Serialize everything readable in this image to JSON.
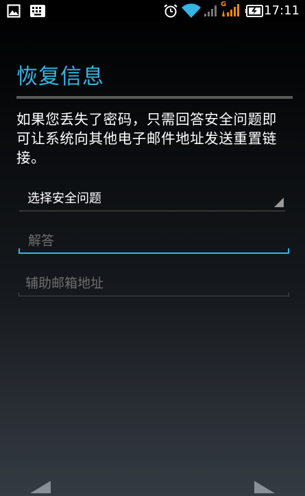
{
  "status_bar": {
    "time": "17:11",
    "network_label": "G",
    "icons": [
      "image-icon",
      "keyboard-icon",
      "alarm-icon",
      "wifi-icon",
      "signal-icon",
      "signal-icon-secondary",
      "battery-icon"
    ]
  },
  "page": {
    "title": "恢复信息",
    "description": "如果您丢失了密码，只需回答安全问题即可让系统向其他电子邮件地址发送重置链接。"
  },
  "form": {
    "security_question": {
      "selected": "选择安全问题"
    },
    "answer": {
      "placeholder": "解答",
      "value": ""
    },
    "backup_email": {
      "placeholder": "辅助邮箱地址",
      "value": ""
    }
  },
  "navigation": {
    "icons": [
      "back-arrow-icon",
      "next-arrow-icon"
    ]
  },
  "colors": {
    "accent": "#33b5e5",
    "text": "#ffffff",
    "hint": "#6d6d6d",
    "signal_orange": "#ff8a00"
  }
}
